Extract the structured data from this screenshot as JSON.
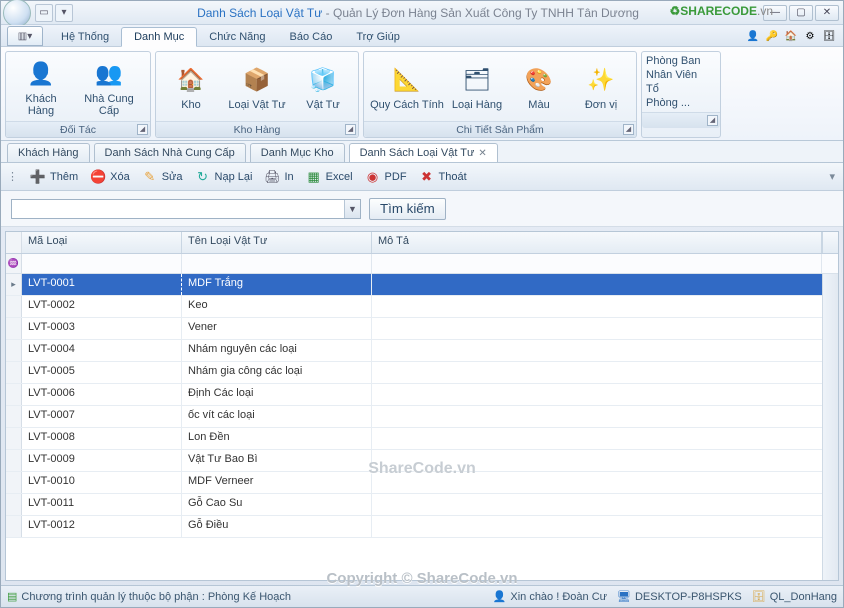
{
  "title": {
    "main": "Danh Sách Loại Vật Tư",
    "sub": "Quản Lý Đơn Hàng Sản Xuất Công Ty TNHH Tân Dương"
  },
  "brand": {
    "name": "SHARECODE",
    "suffix": ".vn"
  },
  "menu": {
    "tabs": [
      "Hệ Thống",
      "Danh Mục",
      "Chức Năng",
      "Báo Cáo",
      "Trợ Giúp"
    ],
    "active": 1
  },
  "ribbon": {
    "groups": [
      {
        "caption": "Đối Tác",
        "items": [
          {
            "label": "Khách Hàng",
            "icon": "👤"
          },
          {
            "label": "Nhà Cung Cấp",
            "icon": "👥"
          }
        ]
      },
      {
        "caption": "Kho Hàng",
        "items": [
          {
            "label": "Kho",
            "icon": "🏠"
          },
          {
            "label": "Loại Vật Tư",
            "icon": "📦"
          },
          {
            "label": "Vật Tư",
            "icon": "🧊"
          }
        ]
      },
      {
        "caption": "Chi Tiết Sản Phẩm",
        "items": [
          {
            "label": "Quy Cách Tính",
            "icon": "📐"
          },
          {
            "label": "Loại Hàng",
            "icon": "🗂"
          },
          {
            "label": "Màu",
            "icon": "🎨"
          },
          {
            "label": "Đơn vị",
            "icon": "✨"
          }
        ]
      },
      {
        "links": [
          "Phòng Ban",
          "Nhân Viên",
          "Tổ",
          "Phòng ..."
        ]
      }
    ]
  },
  "doctabs": [
    {
      "label": "Khách Hàng"
    },
    {
      "label": "Danh Sách Nhà Cung Cấp"
    },
    {
      "label": "Danh Mục Kho"
    },
    {
      "label": "Danh Sách Loại Vật Tư",
      "active": true,
      "closable": true
    }
  ],
  "toolbar": {
    "add": "Thêm",
    "del": "Xóa",
    "edit": "Sửa",
    "reload": "Nạp Lại",
    "print": "In",
    "excel": "Excel",
    "pdf": "PDF",
    "exit": "Thoát"
  },
  "search": {
    "value": "",
    "button": "Tìm kiếm"
  },
  "grid": {
    "columns": [
      "Mã Loại",
      "Tên Loại Vật Tư",
      "Mô Tả"
    ],
    "rows": [
      {
        "code": "LVT-0001",
        "name": "MDF Trắng",
        "desc": ""
      },
      {
        "code": "LVT-0002",
        "name": "Keo",
        "desc": ""
      },
      {
        "code": "LVT-0003",
        "name": "Vener",
        "desc": ""
      },
      {
        "code": "LVT-0004",
        "name": "Nhám nguyên các loại",
        "desc": ""
      },
      {
        "code": "LVT-0005",
        "name": "Nhám gia công các loại",
        "desc": ""
      },
      {
        "code": "LVT-0006",
        "name": "Định Các loại",
        "desc": ""
      },
      {
        "code": "LVT-0007",
        "name": "ốc vít các loại",
        "desc": ""
      },
      {
        "code": "LVT-0008",
        "name": "Lon Đền",
        "desc": ""
      },
      {
        "code": "LVT-0009",
        "name": "Vật Tư Bao Bì",
        "desc": ""
      },
      {
        "code": "LVT-0010",
        "name": "MDF Verneer",
        "desc": ""
      },
      {
        "code": "LVT-0011",
        "name": "Gỗ Cao Su",
        "desc": ""
      },
      {
        "code": "LVT-0012",
        "name": "Gỗ Điều",
        "desc": ""
      }
    ],
    "selected": 0
  },
  "status": {
    "left": "Chương trình quản lý thuộc bộ phận : Phòng Kế Hoạch",
    "user": "Xin chào ! Đoàn Cư",
    "host": "DESKTOP-P8HSPKS",
    "db": "QL_DonHang"
  },
  "watermark": {
    "w1": "ShareCode.vn",
    "w2": "Copyright © ShareCode.vn"
  }
}
